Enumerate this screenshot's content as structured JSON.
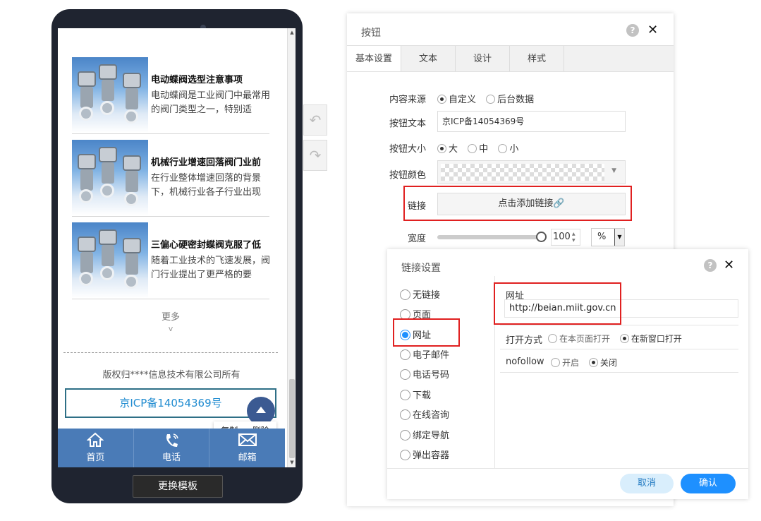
{
  "phone": {
    "news": [
      {
        "title": "电动蝶阀选型注意事项",
        "desc": "电动蝶阀是工业阀门中最常用的阀门类型之一，特别适"
      },
      {
        "title": "机械行业增速回落阀门业前",
        "desc": "在行业整体增速回落的背景下，机械行业各子行业出现"
      },
      {
        "title": "三偏心硬密封蝶阀克服了低",
        "desc": "随着工业技术的飞速发展，阀门行业提出了更严格的要"
      }
    ],
    "more_label": "更多",
    "copyright": "版权归****信息技术有限公司所有",
    "icp_button": "京ICP备14054369号",
    "context_menu": {
      "copy": "复制",
      "delete": "删除"
    },
    "tabbar": [
      {
        "label": "首页",
        "icon": "home-icon"
      },
      {
        "label": "电话",
        "icon": "phone-icon"
      },
      {
        "label": "邮箱",
        "icon": "mail-icon"
      }
    ],
    "change_template": "更换模板"
  },
  "button_panel": {
    "title": "按钮",
    "tabs": [
      "基本设置",
      "文本",
      "设计",
      "样式"
    ],
    "content_source": {
      "label": "内容来源",
      "options": [
        "自定义",
        "后台数据"
      ],
      "selected": "自定义"
    },
    "button_text": {
      "label": "按钮文本",
      "value": "京ICP备14054369号"
    },
    "button_size": {
      "label": "按钮大小",
      "options": [
        "大",
        "中",
        "小"
      ],
      "selected": "大"
    },
    "button_color": {
      "label": "按钮颜色"
    },
    "link": {
      "label": "链接",
      "button": "点击添加链接"
    },
    "width": {
      "label": "宽度",
      "value": "100",
      "unit": "%",
      "level": 1.0
    }
  },
  "link_dialog": {
    "title": "链接设置",
    "options": [
      "无链接",
      "页面",
      "网址",
      "电子邮件",
      "电话号码",
      "下载",
      "在线咨询",
      "绑定导航",
      "弹出容器"
    ],
    "selected": "网址",
    "url_label": "网址",
    "url_value": "http://beian.miit.gov.cn",
    "open_mode": {
      "label": "打开方式",
      "options": [
        "在本页面打开",
        "在新窗口打开"
      ],
      "selected": "在新窗口打开"
    },
    "nofollow": {
      "label": "nofollow",
      "options": [
        "开启",
        "关闭"
      ],
      "selected": "关闭"
    },
    "cancel": "取消",
    "ok": "确认"
  },
  "colors": {
    "accent": "#1e90ff",
    "tabbar": "#4a7bb7",
    "highlight": "#e02020"
  }
}
